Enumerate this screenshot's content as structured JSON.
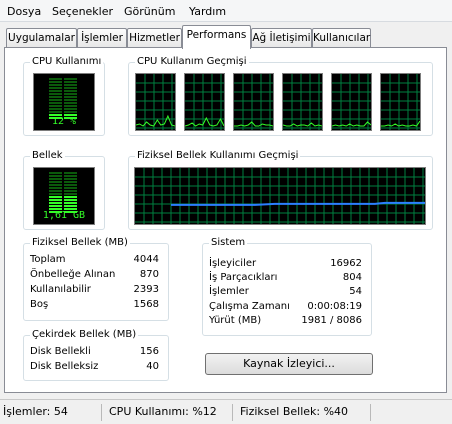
{
  "menu": [
    "Dosya",
    "Seçenekler",
    "Görünüm",
    "Yardım"
  ],
  "tabs": [
    {
      "label": "Uygulamalar",
      "active": false
    },
    {
      "label": "İşlemler",
      "active": false
    },
    {
      "label": "Hizmetler",
      "active": false
    },
    {
      "label": "Performans",
      "active": true
    },
    {
      "label": "Ağ İletişimi",
      "active": false
    },
    {
      "label": "Kullanıcılar",
      "active": false
    }
  ],
  "cpu_usage": {
    "title": "CPU Kullanımı",
    "value_label": "12 %",
    "percent": 12
  },
  "cpu_history": {
    "title": "CPU Kullanım Geçmişi",
    "cores": 6
  },
  "memory": {
    "title": "Bellek",
    "value_label": "1,61 GB",
    "fraction": 0.4
  },
  "memory_history": {
    "title": "Fiziksel Bellek Kullanımı Geçmişi"
  },
  "physical_memory": {
    "title": "Fiziksel Bellek (MB)",
    "rows": [
      {
        "key": "Toplam",
        "value": "4044"
      },
      {
        "key": "Önbelleğe Alınan",
        "value": "870"
      },
      {
        "key": "Kullanılabilir",
        "value": "2393"
      },
      {
        "key": "Boş",
        "value": "1568"
      }
    ]
  },
  "kernel_memory": {
    "title": "Çekirdek Bellek (MB)",
    "rows": [
      {
        "key": "Disk Bellekli",
        "value": "156"
      },
      {
        "key": "Disk Belleksiz",
        "value": "40"
      }
    ]
  },
  "system": {
    "title": "Sistem",
    "rows": [
      {
        "key": "İşleyiciler",
        "value": "16962"
      },
      {
        "key": "İş Parçacıkları",
        "value": "804"
      },
      {
        "key": "İşlemler",
        "value": "54"
      },
      {
        "key": "Çalışma Zamanı",
        "value": "0:00:08:19"
      },
      {
        "key": "Yürüt (MB)",
        "value": "1981 / 8086"
      }
    ]
  },
  "resource_monitor_button": "Kaynak İzleyici...",
  "status": {
    "processes": "İşlemler: 54",
    "cpu": "CPU Kullanımı: %12",
    "memory": "Fiziksel Bellek: %40"
  },
  "colors": {
    "graph_line": "#34ff28",
    "graph_grid": "#008040",
    "memory_line": "#2b7fff"
  }
}
